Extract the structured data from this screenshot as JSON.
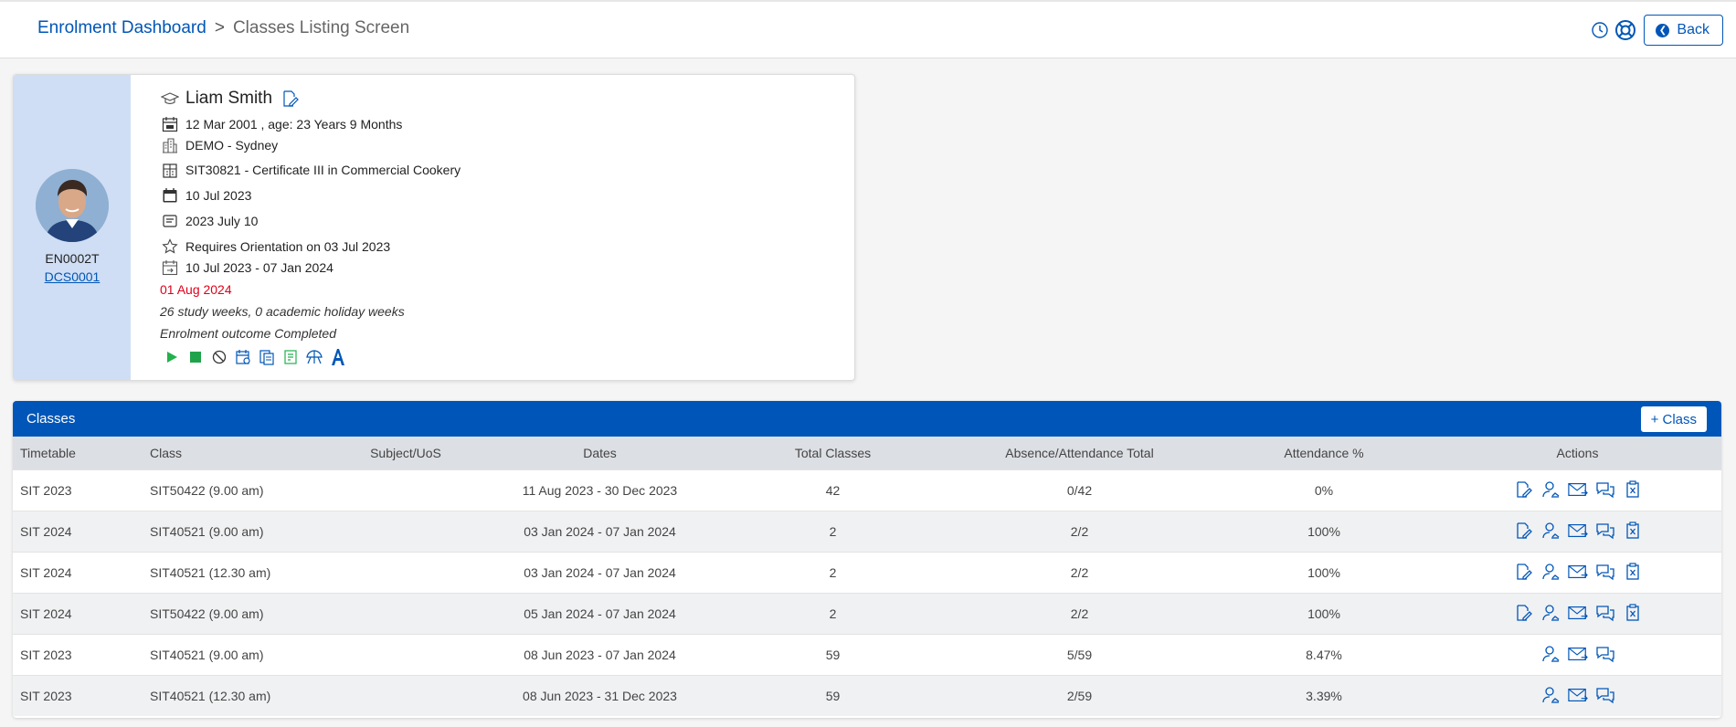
{
  "breadcrumb": {
    "parent": "Enrolment Dashboard",
    "separator": ">",
    "current": "Classes Listing Screen"
  },
  "toolbar": {
    "back_label": "Back"
  },
  "colors": {
    "accent": "#0056b8",
    "danger": "#e0001b",
    "success": "#22b14c"
  },
  "student": {
    "id": "EN0002T",
    "code": "DCS0001",
    "name": "Liam Smith",
    "dob": "12 Mar 2001 , age: 23 Years 9 Months",
    "campus": "DEMO - Sydney",
    "course": "SIT30821 - Certificate III in Commercial Cookery",
    "start_date": "10 Jul 2023",
    "intake": "2023 July 10",
    "orientation": "Requires Orientation on 03 Jul 2023",
    "period": "10 Jul 2023 - 07 Jan 2024",
    "alert_date": "01 Aug 2024",
    "weeks": "26 study weeks, 0 academic holiday weeks",
    "outcome": "Enrolment outcome Completed"
  },
  "classes": {
    "title": "Classes",
    "add_label": "+ Class",
    "columns": {
      "timetable": "Timetable",
      "class": "Class",
      "subject": "Subject/UoS",
      "dates": "Dates",
      "total": "Total Classes",
      "absence": "Absence/Attendance Total",
      "attendance": "Attendance %",
      "actions": "Actions"
    },
    "rows": [
      {
        "timetable": "SIT 2023",
        "class": "SIT50422 (9.00 am)",
        "subject": "",
        "dates": "11 Aug 2023 - 30 Dec 2023",
        "total": "42",
        "absence": "0/42",
        "attendance": "0%"
      },
      {
        "timetable": "SIT 2024",
        "class": "SIT40521 (9.00 am)",
        "subject": "",
        "dates": "03 Jan 2024 - 07 Jan 2024",
        "total": "2",
        "absence": "2/2",
        "attendance": "100%"
      },
      {
        "timetable": "SIT 2024",
        "class": "SIT40521 (12.30 am)",
        "subject": "",
        "dates": "03 Jan 2024 - 07 Jan 2024",
        "total": "2",
        "absence": "2/2",
        "attendance": "100%"
      },
      {
        "timetable": "SIT 2024",
        "class": "SIT50422 (9.00 am)",
        "subject": "",
        "dates": "05 Jan 2024 - 07 Jan 2024",
        "total": "2",
        "absence": "2/2",
        "attendance": "100%"
      },
      {
        "timetable": "SIT 2023",
        "class": "SIT40521 (9.00 am)",
        "subject": "",
        "dates": "08 Jun 2023 - 07 Jan 2024",
        "total": "59",
        "absence": "5/59",
        "attendance": "8.47%"
      },
      {
        "timetable": "SIT 2023",
        "class": "SIT40521 (12.30 am)",
        "subject": "",
        "dates": "08 Jun 2023 - 31 Dec 2023",
        "total": "59",
        "absence": "2/59",
        "attendance": "3.39%"
      }
    ]
  }
}
